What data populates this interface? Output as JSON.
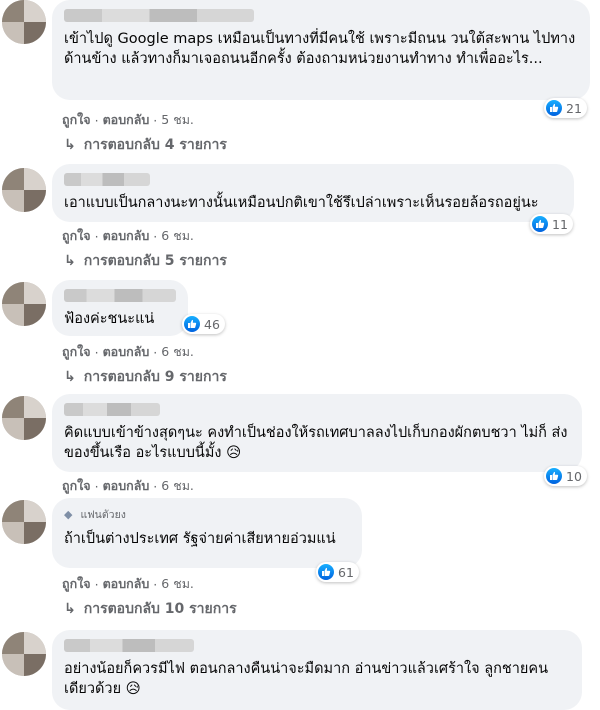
{
  "comments": [
    {
      "text": "เข้าไปดู Google maps เหมือนเป็นทางที่มีคนใช้ เพราะมีถนน วนใต้สะพาน ไปทางด้านข้าง แล้วทางก็มาเจอถนนอีกครั้ง ต้องถามหน่วยงานทำทาง ทำเพื่ออะไร...",
      "reactions": "21",
      "like": "ถูกใจ",
      "reply": "ตอบกลับ",
      "time": "5 ชม.",
      "replies": "การตอบกลับ 4 รายการ"
    },
    {
      "text": "เอาแบบเป็นกลางนะทางนั้นเหมือนปกติเขาใช้รึเปล่าเพราะเห็นรอยล้อรถอยู่นะ",
      "reactions": "11",
      "like": "ถูกใจ",
      "reply": "ตอบกลับ",
      "time": "6 ชม.",
      "replies": "การตอบกลับ 5 รายการ"
    },
    {
      "text": "ฟ้องค่ะชนะแน่",
      "reactions": "46",
      "like": "ถูกใจ",
      "reply": "ตอบกลับ",
      "time": "6 ชม.",
      "replies": "การตอบกลับ 9 รายการ"
    },
    {
      "text": "คิดแบบเข้าข้างสุดๆนะ คงทำเป็นช่องให้รถเทศบาลลงไปเก็บกองผักตบชวา ไม่ก็ ส่งของขึ้นเรือ อะไรแบบนี้มั้ง 😥",
      "reactions": "10",
      "like": "ถูกใจ",
      "reply": "ตอบกลับ",
      "time": "6 ชม."
    },
    {
      "badge": "แฟนตัวยง",
      "text": "ถ้าเป็นต่างประเทศ รัฐจ่ายค่าเสียหายอ่วมแน่",
      "reactions": "61",
      "like": "ถูกใจ",
      "reply": "ตอบกลับ",
      "time": "6 ชม.",
      "replies": "การตอบกลับ 10 รายการ"
    },
    {
      "text": "อย่างน้อยก็ควรมีไฟ ตอนกลางคืนน่าจะมืดมาก อ่านข่าวแล้วเศร้าใจ ลูกชายคนเดียวด้วย 😥"
    }
  ],
  "colors": {
    "bubble": "#f0f2f5",
    "meta": "#65676b",
    "like_blue": "#1877f2"
  },
  "icons": {
    "like": "like-thumb-icon",
    "reply": "reply-arrow-icon",
    "fan": "diamond-icon"
  }
}
